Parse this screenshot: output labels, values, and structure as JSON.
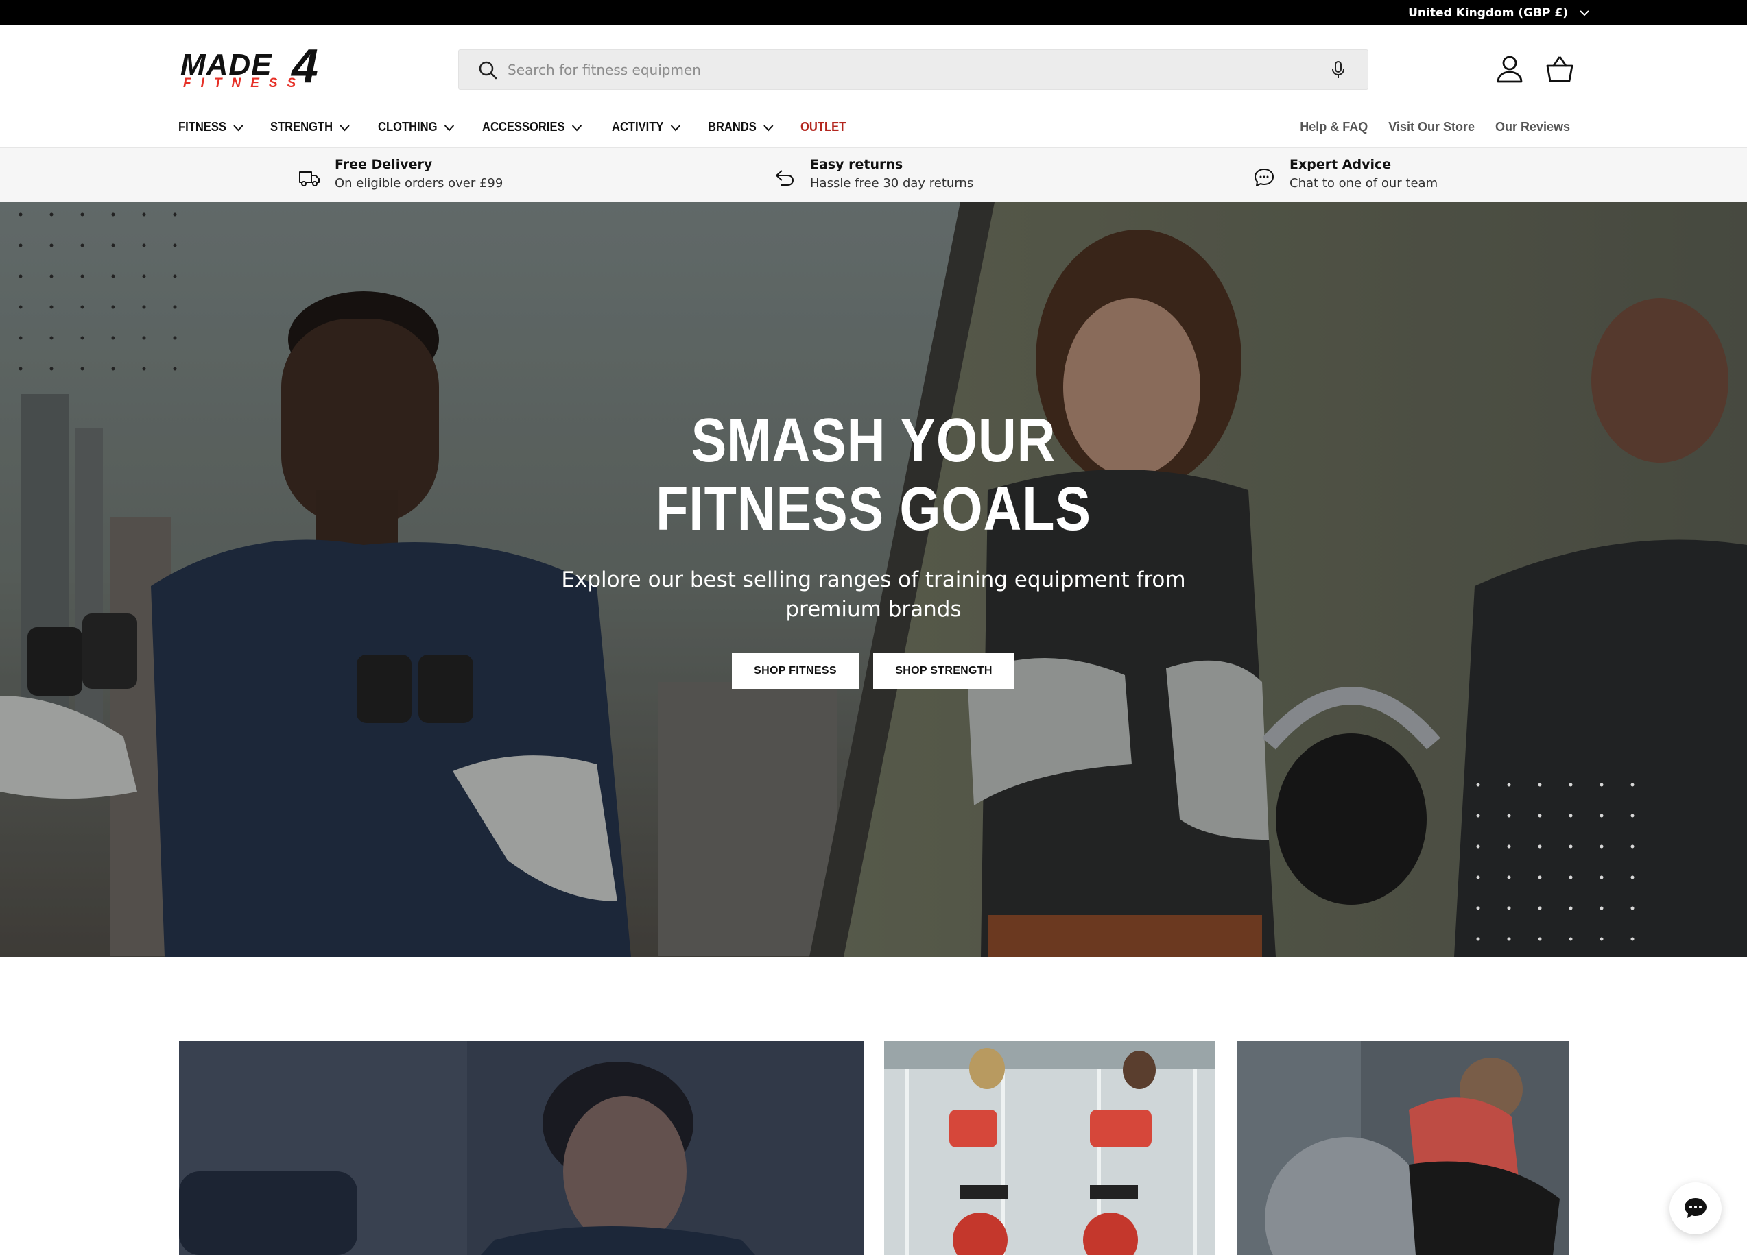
{
  "topbar": {
    "country": "United Kingdom (GBP £)"
  },
  "header": {
    "logo_top": "MADE",
    "logo_number": "4",
    "logo_bottom": "FITNESS",
    "search_placeholder": "Search for fitness equipmen"
  },
  "nav": {
    "items": [
      {
        "label": "FITNESS",
        "dropdown": true
      },
      {
        "label": "STRENGTH",
        "dropdown": true
      },
      {
        "label": "CLOTHING",
        "dropdown": true
      },
      {
        "label": "ACCESSORIES",
        "dropdown": true
      },
      {
        "label": "ACTIVITY",
        "dropdown": true
      },
      {
        "label": "BRANDS",
        "dropdown": true
      },
      {
        "label": "OUTLET",
        "dropdown": false,
        "color": "#b3261e"
      }
    ],
    "links": [
      "Help & FAQ",
      "Visit Our Store",
      "Our Reviews"
    ]
  },
  "usps": [
    {
      "icon": "delivery-truck-icon",
      "title": "Free Delivery",
      "subtitle": "On eligible orders over £99"
    },
    {
      "icon": "return-arrow-icon",
      "title": "Easy returns",
      "subtitle": "Hassle free 30 day returns"
    },
    {
      "icon": "chat-bubble-icon",
      "title": "Expert Advice",
      "subtitle": "Chat to one of our team"
    }
  ],
  "hero": {
    "title_line1": "SMASH YOUR",
    "title_line2": "FITNESS GOALS",
    "subtitle": "Explore our best selling ranges of training equipment from premium brands",
    "buttons": [
      "SHOP FITNESS",
      "SHOP STRENGTH"
    ]
  },
  "colors": {
    "accent_red": "#e63027",
    "outlet_red": "#b3261e",
    "topbar": "#000000",
    "usp_bg": "#f6f6f6"
  }
}
